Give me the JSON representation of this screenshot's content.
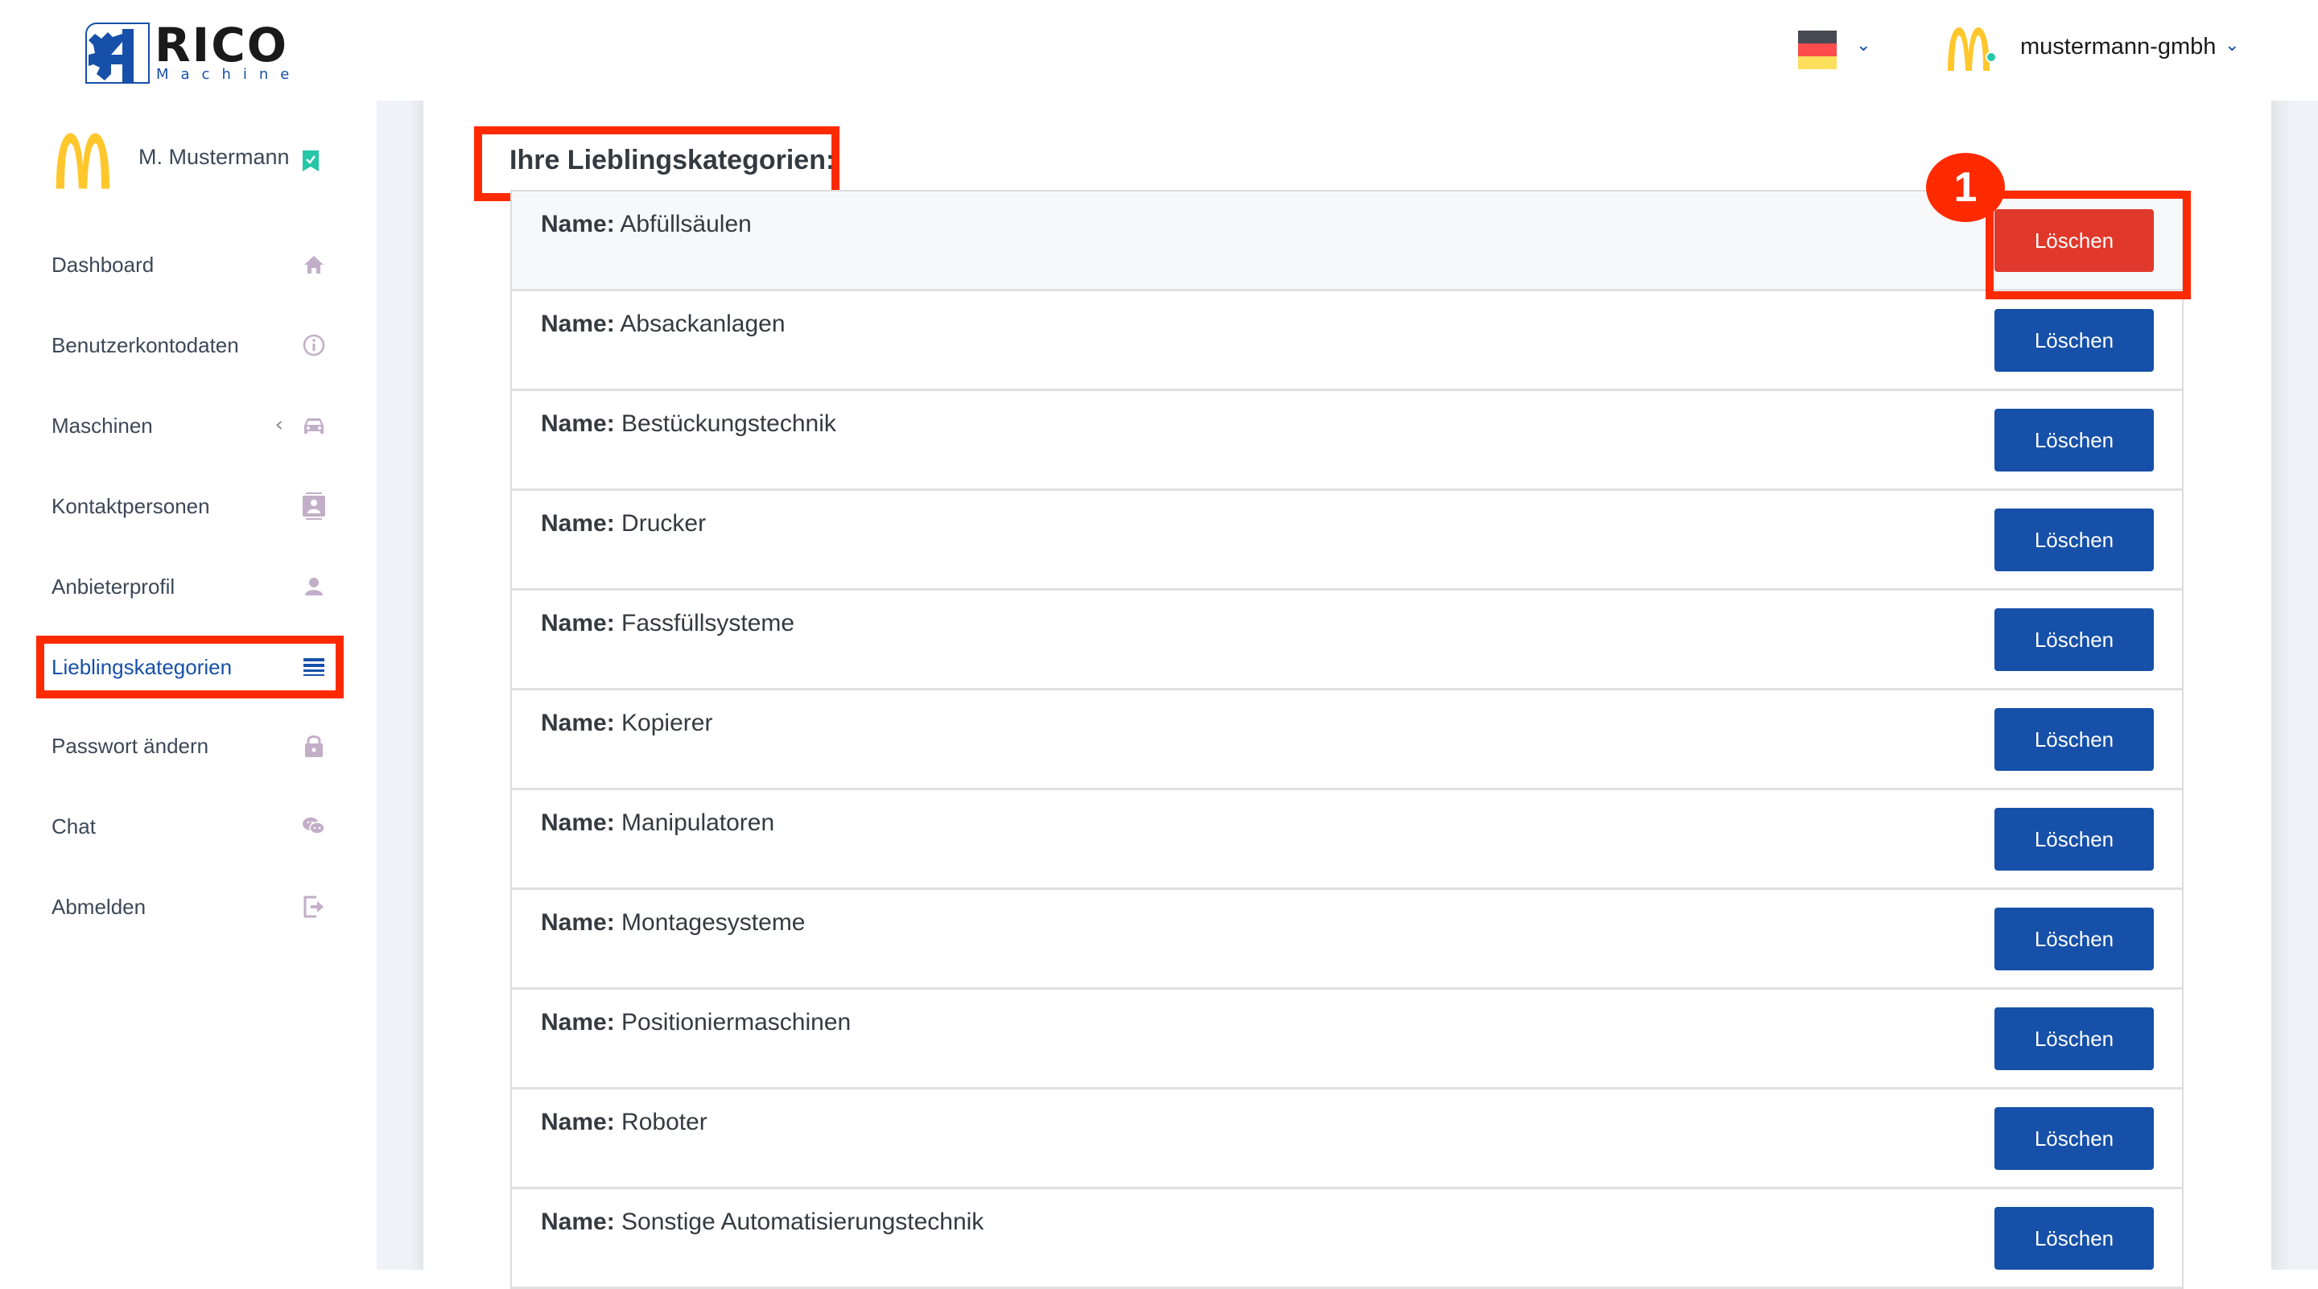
{
  "header": {
    "logo_word": "RICO",
    "logo_sub": "Machine",
    "language": "de",
    "language_icon": "flag-germany-icon",
    "account_name": "mustermann-gmbh"
  },
  "profile": {
    "name": "M. Mustermann",
    "verified_icon": "verified-bookmark-icon"
  },
  "sidebar": {
    "items": [
      {
        "label": "Dashboard",
        "icon": "home-icon"
      },
      {
        "label": "Benutzerkontodaten",
        "icon": "info-icon"
      },
      {
        "label": "Maschinen",
        "icon": "car-icon",
        "expandable": true
      },
      {
        "label": "Kontaktpersonen",
        "icon": "contact-card-icon"
      },
      {
        "label": "Anbieterprofil",
        "icon": "user-icon"
      },
      {
        "label": "Lieblingskategorien",
        "icon": "list-icon",
        "active": true
      },
      {
        "label": "Passwort ändern",
        "icon": "lock-icon"
      },
      {
        "label": "Chat",
        "icon": "chat-icon"
      },
      {
        "label": "Abmelden",
        "icon": "logout-icon"
      }
    ]
  },
  "main": {
    "title": "Ihre Lieblingskategorien:",
    "name_prefix": "Name:",
    "delete_label": "Löschen",
    "categories": [
      "Abfüllsäulen",
      "Absackanlagen",
      "Bestückungstechnik",
      "Drucker",
      "Fassfüllsysteme",
      "Kopierer",
      "Manipulatoren",
      "Montagesysteme",
      "Positioniermaschinen",
      "Roboter",
      "Sonstige Automatisierungstechnik"
    ]
  },
  "annotation": {
    "step_number": "1"
  },
  "colors": {
    "primary": "#1650a8",
    "danger": "#e0392b",
    "annotation": "#ff2a00",
    "icon_muted": "#c3aec8"
  }
}
